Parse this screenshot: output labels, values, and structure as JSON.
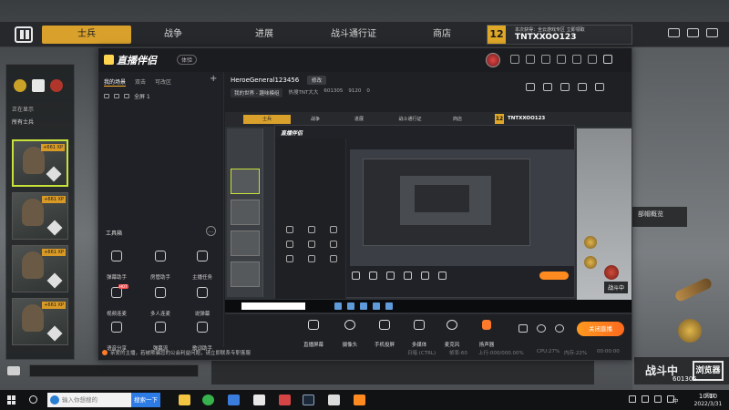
{
  "game": {
    "tabs": [
      "士兵",
      "战争",
      "进展",
      "战斗通行证",
      "商店"
    ],
    "active_tab": "士兵",
    "level": "12",
    "badge_sub": "本次获得：全云游戏专区 立即领取",
    "player_name": "TNTXXOO123",
    "left_panel": {
      "label_shown": "正在显示",
      "label_all": "所有士兵",
      "soldier_tags": [
        "+661 XP",
        "+661 XP",
        "+661 XP",
        "+661 XP"
      ]
    },
    "right_label": "部帽概览",
    "status_text": "战斗中",
    "status_logo": "浏览器",
    "viewer_count": "601305"
  },
  "streamer_app": {
    "logo": "直播伴侣",
    "version_badge": "体验",
    "side_tabs": [
      "我的场景",
      "双击",
      "可改区"
    ],
    "scene_item": "全屏 1",
    "tools_title": "工具箱",
    "tools": [
      {
        "label": "弹幕助手",
        "hot": ""
      },
      {
        "label": "房管助手",
        "hot": ""
      },
      {
        "label": "主播任务",
        "hot": ""
      },
      {
        "label": "视频连麦",
        "hot": "HOT"
      },
      {
        "label": "多人连麦",
        "hot": ""
      },
      {
        "label": "说弹幕",
        "hot": ""
      },
      {
        "label": "语音分享",
        "hot": ""
      },
      {
        "label": "弹幕流",
        "hot": ""
      },
      {
        "label": "歌词助手",
        "hot": ""
      },
      {
        "label": "礼物",
        "hot": "NEW"
      },
      {
        "label": "音效",
        "hot": ""
      },
      {
        "label": "",
        "hot": ""
      }
    ],
    "notice": "亲爱的主播，若被欺骗您的公会利益问题，请立即联系专职客服",
    "room": {
      "name": "HeroeGeneral123456",
      "edit_label": "修改",
      "chip": "我的世界 - 趣味模组",
      "streamer": "热搜TNT大大",
      "room_id": "601305",
      "likes": "9120",
      "fans": "0"
    },
    "preview": {
      "tabs": [
        "士兵",
        "战争",
        "进展",
        "战斗通行证",
        "商店"
      ],
      "level": "12",
      "name": "TNTXXOO123",
      "app_logo": "直播伴侣",
      "status": "战斗中"
    },
    "controls": [
      {
        "label": "直播屏幕"
      },
      {
        "label": "摄像头"
      },
      {
        "label": "手机投屏"
      },
      {
        "label": "多媒体"
      },
      {
        "label": "麦克风"
      },
      {
        "label": "扬声器"
      }
    ],
    "start_button": "关闭直播",
    "stats": [
      "日暗 (CTRL)",
      "帧率:60",
      "上行:000/000.00%",
      "CPU:27%",
      "内存:22%",
      "00:00:00"
    ]
  },
  "taskbar": {
    "search_placeholder": "输入你想搜的",
    "search_button": "搜索一下",
    "ime": "中",
    "time": "10:10",
    "date": "2022/3/31",
    "weekday": "周四"
  },
  "colors": {
    "accent": "#d9a12c",
    "brand_orange": "#ff7a2a",
    "selection": "#c8e23a"
  }
}
